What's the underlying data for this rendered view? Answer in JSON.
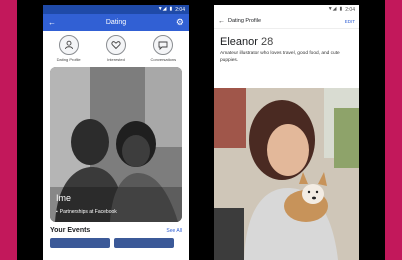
{
  "left_screen": {
    "status": {
      "time": "2:04"
    },
    "appbar": {
      "title": "Dating"
    },
    "shortcuts": [
      {
        "label": "Dating Profile",
        "icon": "person-icon"
      },
      {
        "label": "Interested",
        "icon": "heart-icon"
      },
      {
        "label": "Conversations",
        "icon": "chat-icon"
      }
    ],
    "card": {
      "name": "Ime",
      "partner": "Partnerships at Facebook"
    },
    "events": {
      "title": "Your Events",
      "see_all": "See All"
    }
  },
  "right_screen": {
    "status": {
      "time": "2:04"
    },
    "appbar": {
      "title": "Dating Profile",
      "edit": "EDIT"
    },
    "profile": {
      "name": "Eleanor",
      "age": "28",
      "bio": "Amateur illustrator who loves travel, good food, and cute puppies."
    }
  },
  "colors": {
    "background": "#c2185b",
    "appbar": "#3160d4",
    "statusbar": "#1f4aa8"
  }
}
